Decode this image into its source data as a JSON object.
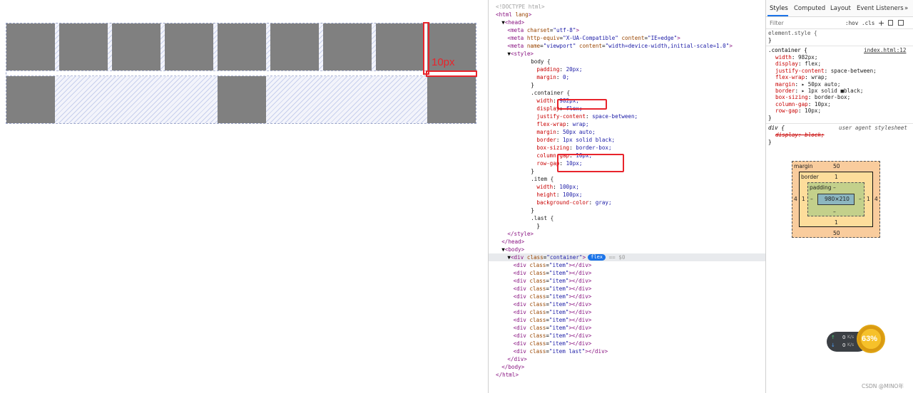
{
  "preview": {
    "annotation_label": "10px",
    "row1_cells": 9,
    "row2_filled_cells": [
      0,
      4,
      8
    ]
  },
  "elements": {
    "lines": [
      {
        "text": "<!DOCTYPE html>",
        "indent": 0
      },
      {
        "text": "<html lang>",
        "indent": 0
      },
      {
        "text": "▼<head>",
        "indent": 1
      },
      {
        "text": "<meta charset=\"utf-8\">",
        "indent": 2
      },
      {
        "text": "<meta http-equiv=\"X-UA-Compatible\" content=\"IE=edge\">",
        "indent": 2
      },
      {
        "text": "<meta name=\"viewport\" content=\"width=device-width,initial-scale=1.0\">",
        "indent": 2
      },
      {
        "text": "▼<style>",
        "indent": 2
      },
      {
        "text": "body {",
        "indent": 6
      },
      {
        "text": "padding: 20px;",
        "indent": 7
      },
      {
        "text": "margin: 0;",
        "indent": 7
      },
      {
        "text": "}",
        "indent": 6
      },
      {
        "text": ".container {",
        "indent": 6
      },
      {
        "text": "width: 982px;",
        "indent": 7
      },
      {
        "text": "display: flex;",
        "indent": 7
      },
      {
        "text": "justify-content: space-between;",
        "indent": 7
      },
      {
        "text": "flex-wrap: wrap;",
        "indent": 7
      },
      {
        "text": "margin: 50px auto;",
        "indent": 7
      },
      {
        "text": "border: 1px solid black;",
        "indent": 7
      },
      {
        "text": "box-sizing: border-box;",
        "indent": 7
      },
      {
        "text": "column-gap: 10px;",
        "indent": 7
      },
      {
        "text": "row-gap: 10px;",
        "indent": 7
      },
      {
        "text": "}",
        "indent": 6
      },
      {
        "text": ".item {",
        "indent": 6
      },
      {
        "text": "width: 100px;",
        "indent": 7
      },
      {
        "text": "height: 100px;",
        "indent": 7
      },
      {
        "text": "background-color: gray;",
        "indent": 7
      },
      {
        "text": "}",
        "indent": 6
      },
      {
        "text": ".last {",
        "indent": 6
      },
      {
        "text": "}",
        "indent": 7
      },
      {
        "text": "</style>",
        "indent": 2
      },
      {
        "text": "</head>",
        "indent": 1
      },
      {
        "text": "▼<body>",
        "indent": 1
      },
      {
        "text": "▼<div class=\"container\">",
        "indent": 2,
        "badge": "flex",
        "suffix": " == $0",
        "selected": true
      },
      {
        "text": "<div class=\"item\"></div>",
        "indent": 3
      },
      {
        "text": "<div class=\"item\"></div>",
        "indent": 3
      },
      {
        "text": "<div class=\"item\"></div>",
        "indent": 3
      },
      {
        "text": "<div class=\"item\"></div>",
        "indent": 3
      },
      {
        "text": "<div class=\"item\"></div>",
        "indent": 3
      },
      {
        "text": "<div class=\"item\"></div>",
        "indent": 3
      },
      {
        "text": "<div class=\"item\"></div>",
        "indent": 3
      },
      {
        "text": "<div class=\"item\"></div>",
        "indent": 3
      },
      {
        "text": "<div class=\"item\"></div>",
        "indent": 3
      },
      {
        "text": "<div class=\"item\"></div>",
        "indent": 3
      },
      {
        "text": "<div class=\"item\"></div>",
        "indent": 3
      },
      {
        "text": "<div class=\"item last\"></div>",
        "indent": 3
      },
      {
        "text": "</div>",
        "indent": 2
      },
      {
        "text": "</body>",
        "indent": 1
      },
      {
        "text": "</html>",
        "indent": 0
      }
    ]
  },
  "styles": {
    "tabs": [
      "Styles",
      "Computed",
      "Layout",
      "Event Listeners",
      "»"
    ],
    "filter_placeholder": "Filter",
    "filter_tools": [
      ":hov",
      ".cls",
      "+"
    ],
    "element_style_selector": "element.style {",
    "element_style_close": "}",
    "rule_selector": ".container {",
    "rule_source": "index.html:12",
    "rule_props": [
      {
        "name": "width",
        "value": "982px;"
      },
      {
        "name": "display",
        "value": "flex;"
      },
      {
        "name": "justify-content",
        "value": "space-between;"
      },
      {
        "name": "flex-wrap",
        "value": "wrap;"
      },
      {
        "name": "margin",
        "value": "▸ 50px auto;"
      },
      {
        "name": "border",
        "value": "▸ 1px solid ■black;"
      },
      {
        "name": "box-sizing",
        "value": "border-box;"
      },
      {
        "name": "column-gap",
        "value": "10px;"
      },
      {
        "name": "row-gap",
        "value": "10px;"
      }
    ],
    "rule_close": "}",
    "ua_selector": "div {",
    "ua_source": "user agent stylesheet",
    "ua_prop": "display: block;",
    "ua_close": "}",
    "box_model": {
      "margin_label": "margin",
      "margin_top": "50",
      "margin_bottom": "50",
      "margin_left": "4",
      "margin_right": "4",
      "border_label": "border",
      "border_top": "1",
      "border_bottom": "1",
      "border_left": "1",
      "border_right": "1",
      "padding_label": "padding",
      "padding_top": "–",
      "padding_bottom": "–",
      "padding_left": "–",
      "padding_right": "–",
      "content": "980×210"
    }
  },
  "widget": {
    "up_speed": "0",
    "down_speed": "0",
    "unit": "K/s",
    "percent": "63%"
  },
  "watermark": "CSDN @MINO年"
}
